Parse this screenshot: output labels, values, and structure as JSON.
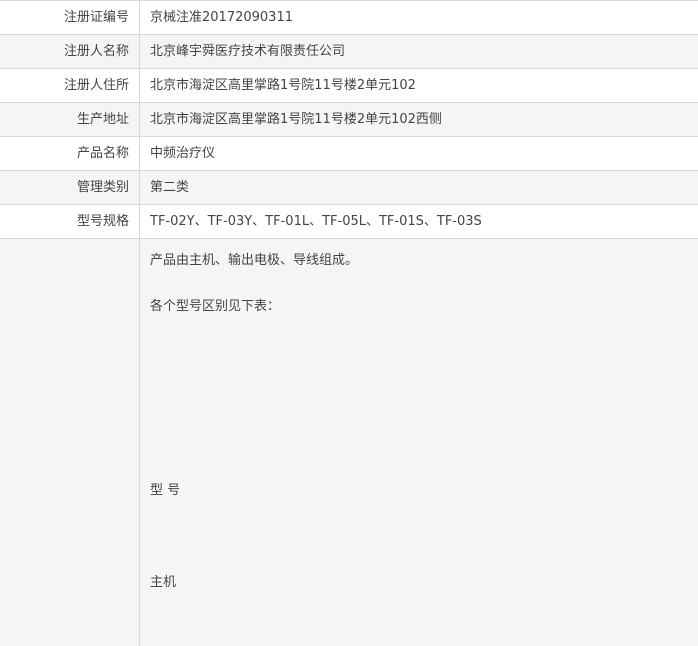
{
  "rows": [
    {
      "label": "注册证编号",
      "value": "京械注准20172090311"
    },
    {
      "label": "注册人名称",
      "value": "北京峰宇舜医疗技术有限责任公司"
    },
    {
      "label": "注册人住所",
      "value": "北京市海淀区高里掌路1号院11号楼2单元102"
    },
    {
      "label": "生产地址",
      "value": "北京市海淀区高里掌路1号院11号楼2单元102西侧"
    },
    {
      "label": "产品名称",
      "value": "中频治疗仪"
    },
    {
      "label": "管理类别",
      "value": "第二类"
    },
    {
      "label": "型号规格",
      "value": "TF-02Y、TF-03Y、TF-01L、TF-05L、TF-01S、TF-03S"
    }
  ],
  "structure": {
    "label": "",
    "line1": "产品由主机、输出电极、导线组成。",
    "line2": "各个型号区别见下表：",
    "line3": "型 号",
    "line4": "主机"
  }
}
